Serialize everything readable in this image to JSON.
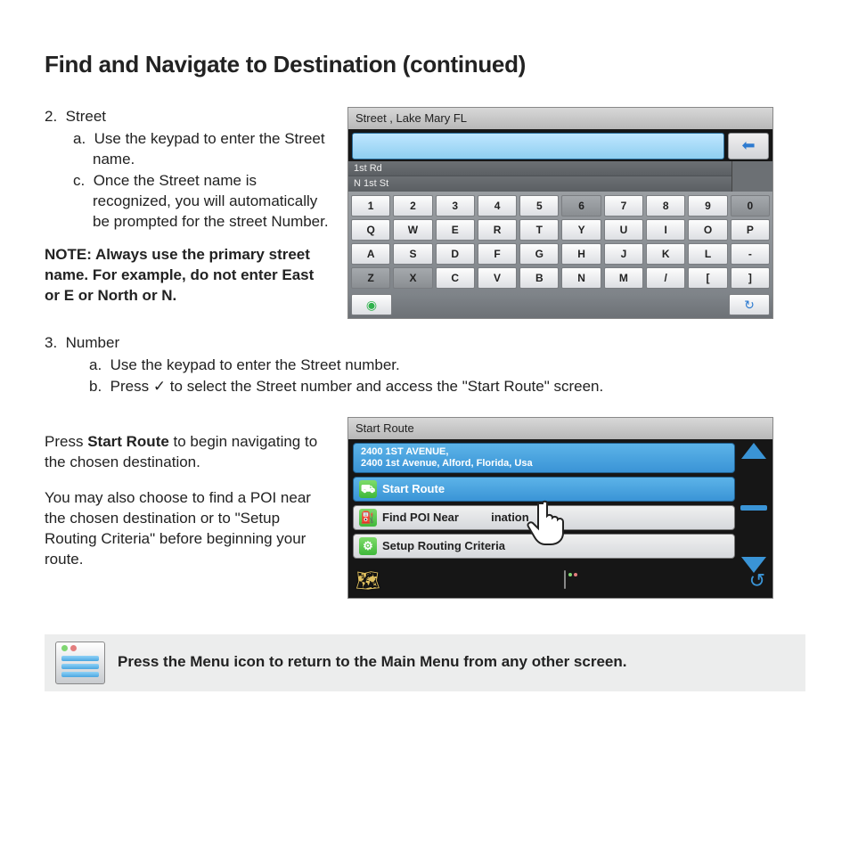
{
  "title": "Find and Navigate to Destination (continued)",
  "step2": {
    "num": "2.",
    "label": "Street",
    "a_letter": "a.",
    "a": "Use the keypad to enter the Street name.",
    "c_letter": "c.",
    "c": "Once the Street name is recognized, you will automatically be prompted for the street Number."
  },
  "note": "NOTE: Always use the primary street name. For example, do not enter East or E or North or N.",
  "step3": {
    "num": "3.",
    "label": "Number",
    "a_letter": "a.",
    "a": "Use the keypad to enter the Street number.",
    "b_letter": "b.",
    "b_pre": "Press ",
    "b_check": "✓",
    "b_post": " to select the Street number and access the \"Start Route\" screen."
  },
  "start_para1_pre": "Press ",
  "start_para1_bold": "Start Route",
  "start_para1_post": " to begin navigating to the chosen destination.",
  "start_para2": "You may also choose to find a POI near the chosen destination or to \"Setup Routing Criteria\" before beginning your route.",
  "gps1": {
    "title": "Street , Lake Mary FL",
    "suggest1": "1st Rd",
    "suggest2": "N 1st St",
    "row1": [
      "1",
      "2",
      "3",
      "4",
      "5",
      "6",
      "7",
      "8",
      "9",
      "0"
    ],
    "row2": [
      "Q",
      "W",
      "E",
      "R",
      "T",
      "Y",
      "U",
      "I",
      "O",
      "P"
    ],
    "row3": [
      "A",
      "S",
      "D",
      "F",
      "G",
      "H",
      "J",
      "K",
      "L",
      "-"
    ],
    "row4": [
      "Z",
      "X",
      "C",
      "V",
      "B",
      "N",
      "M",
      "/",
      "[",
      "]"
    ],
    "dark_row1": [
      5,
      9
    ],
    "dark_row4": [
      0,
      1
    ]
  },
  "gps2": {
    "title": "Start Route",
    "addr_line1": "2400 1ST AVENUE,",
    "addr_line2": "2400 1st Avenue, Alford, Florida, Usa",
    "item1": "Start Route",
    "item2": "Find POI Near          ination",
    "item3": "Setup Routing Criteria"
  },
  "footer": "Press the Menu icon to return to the Main Menu from any other screen."
}
